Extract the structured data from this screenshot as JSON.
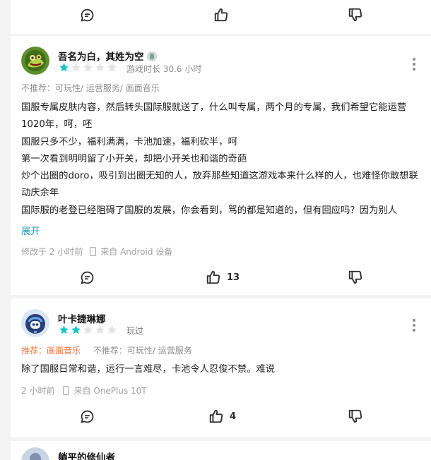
{
  "reviews": [
    {
      "username": "吾名为白，其姓为空",
      "rating": 1,
      "meta": "游戏时长 30.6 小时",
      "not_recommend": "不推荐：可玩性/ 运营服务/ 画面音乐",
      "lines": [
        "国服专属皮肤内容，然后转头国际服就送了，什么叫专属，两个月的专属，我们希望它能运营1020年，呵，呸",
        "国服只多不少，福利满满，卡池加速，福利砍半，呵",
        "第一次看到明明留了小开关，却把小开关也和谐的奇葩",
        "炒个出圈的doro，吸引到出圈无知的人，放弃那些知道这游戏本来什么样的人，也难怪你敢想联动庆余年",
        "国际服的老登已经阻碍了国服的发展，你会看到，骂的都是知道的，但有回应吗？因为别人"
      ],
      "expand_label": "展开",
      "edited": "修改于 2 小时前",
      "device": "来自 Android 设备",
      "like_count": "13"
    },
    {
      "username": "叶卡捷琳娜",
      "rating": 2,
      "meta": "玩过",
      "recommend": "推荐：画面音乐",
      "not_recommend": "不推荐：可玩性/ 运营服务",
      "lines": [
        "除了国服日常和谐，运行一言难尽，卡池令人忍俊不禁。难说"
      ],
      "time": "2 小时前",
      "device": "来自 OnePlus 10T",
      "like_count": "4"
    },
    {
      "username": "躺平的修仙者"
    }
  ],
  "colors": {
    "star_on": "#17c5c5",
    "star_off": "#e3e3e3",
    "link": "#14a3b8",
    "recommend": "#e8743b"
  }
}
